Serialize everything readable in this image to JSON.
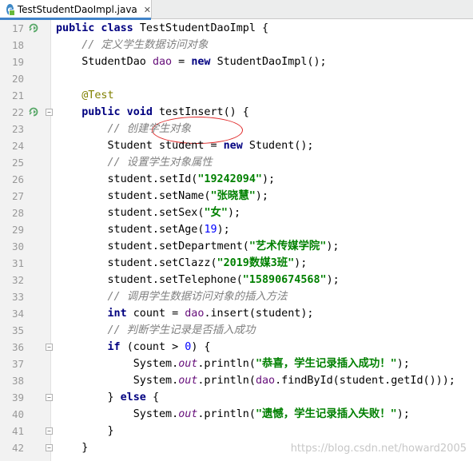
{
  "tab": {
    "title": "TestStudentDaoImpl.java",
    "icon": "class-c-icon"
  },
  "lines": [
    {
      "n": "17",
      "run": true,
      "fold": false,
      "tokens": [
        [
          "kw",
          "public class "
        ],
        [
          "t",
          "TestStudentDaoImpl {"
        ]
      ]
    },
    {
      "n": "18",
      "run": false,
      "fold": false,
      "tokens": [
        [
          "t",
          "    "
        ],
        [
          "cm",
          "// 定义学生数据访问对象"
        ]
      ]
    },
    {
      "n": "19",
      "run": false,
      "fold": false,
      "tokens": [
        [
          "t",
          "    StudentDao "
        ],
        [
          "fld",
          "dao"
        ],
        [
          "t",
          " = "
        ],
        [
          "kw",
          "new "
        ],
        [
          "t",
          "StudentDaoImpl();"
        ]
      ]
    },
    {
      "n": "20",
      "run": false,
      "fold": false,
      "tokens": []
    },
    {
      "n": "21",
      "run": false,
      "fold": false,
      "tokens": [
        [
          "t",
          "    "
        ],
        [
          "an",
          "@Test"
        ]
      ]
    },
    {
      "n": "22",
      "run": true,
      "fold": true,
      "tokens": [
        [
          "t",
          "    "
        ],
        [
          "kw",
          "public void "
        ],
        [
          "t",
          "testInsert() {"
        ]
      ]
    },
    {
      "n": "23",
      "run": false,
      "fold": false,
      "tokens": [
        [
          "t",
          "        "
        ],
        [
          "cm",
          "// 创建学生对象"
        ]
      ]
    },
    {
      "n": "24",
      "run": false,
      "fold": false,
      "tokens": [
        [
          "t",
          "        Student student = "
        ],
        [
          "kw",
          "new "
        ],
        [
          "t",
          "Student();"
        ]
      ]
    },
    {
      "n": "25",
      "run": false,
      "fold": false,
      "tokens": [
        [
          "t",
          "        "
        ],
        [
          "cm",
          "// 设置学生对象属性"
        ]
      ]
    },
    {
      "n": "26",
      "run": false,
      "fold": false,
      "tokens": [
        [
          "t",
          "        student.setId("
        ],
        [
          "str",
          "\"19242094\""
        ],
        [
          "t",
          ");"
        ]
      ]
    },
    {
      "n": "27",
      "run": false,
      "fold": false,
      "tokens": [
        [
          "t",
          "        student.setName("
        ],
        [
          "str",
          "\"张晓慧\""
        ],
        [
          "t",
          ");"
        ]
      ]
    },
    {
      "n": "28",
      "run": false,
      "fold": false,
      "tokens": [
        [
          "t",
          "        student.setSex("
        ],
        [
          "str",
          "\"女\""
        ],
        [
          "t",
          ");"
        ]
      ]
    },
    {
      "n": "29",
      "run": false,
      "fold": false,
      "tokens": [
        [
          "t",
          "        student.setAge("
        ],
        [
          "num",
          "19"
        ],
        [
          "t",
          ");"
        ]
      ]
    },
    {
      "n": "30",
      "run": false,
      "fold": false,
      "tokens": [
        [
          "t",
          "        student.setDepartment("
        ],
        [
          "str",
          "\"艺术传媒学院\""
        ],
        [
          "t",
          ");"
        ]
      ]
    },
    {
      "n": "31",
      "run": false,
      "fold": false,
      "tokens": [
        [
          "t",
          "        student.setClazz("
        ],
        [
          "str",
          "\"2019数媒3班\""
        ],
        [
          "t",
          ");"
        ]
      ]
    },
    {
      "n": "32",
      "run": false,
      "fold": false,
      "tokens": [
        [
          "t",
          "        student.setTelephone("
        ],
        [
          "str",
          "\"15890674568\""
        ],
        [
          "t",
          ");"
        ]
      ]
    },
    {
      "n": "33",
      "run": false,
      "fold": false,
      "tokens": [
        [
          "t",
          "        "
        ],
        [
          "cm",
          "// 调用学生数据访问对象的插入方法"
        ]
      ]
    },
    {
      "n": "34",
      "run": false,
      "fold": false,
      "tokens": [
        [
          "t",
          "        "
        ],
        [
          "kw",
          "int "
        ],
        [
          "t",
          "count = "
        ],
        [
          "fld",
          "dao"
        ],
        [
          "t",
          ".insert(student);"
        ]
      ]
    },
    {
      "n": "35",
      "run": false,
      "fold": false,
      "tokens": [
        [
          "t",
          "        "
        ],
        [
          "cm",
          "// 判断学生记录是否插入成功"
        ]
      ]
    },
    {
      "n": "36",
      "run": false,
      "fold": true,
      "tokens": [
        [
          "t",
          "        "
        ],
        [
          "kw",
          "if "
        ],
        [
          "t",
          "(count > "
        ],
        [
          "num",
          "0"
        ],
        [
          "t",
          ") {"
        ]
      ]
    },
    {
      "n": "37",
      "run": false,
      "fold": false,
      "tokens": [
        [
          "t",
          "            System."
        ],
        [
          "sfld",
          "out"
        ],
        [
          "t",
          ".println("
        ],
        [
          "str",
          "\"恭喜，学生记录插入成功！\""
        ],
        [
          "t",
          ");"
        ]
      ]
    },
    {
      "n": "38",
      "run": false,
      "fold": false,
      "tokens": [
        [
          "t",
          "            System."
        ],
        [
          "sfld",
          "out"
        ],
        [
          "t",
          ".println("
        ],
        [
          "fld",
          "dao"
        ],
        [
          "t",
          ".findById(student.getId()));"
        ]
      ]
    },
    {
      "n": "39",
      "run": false,
      "fold": true,
      "tokens": [
        [
          "t",
          "        } "
        ],
        [
          "kw",
          "else "
        ],
        [
          "t",
          "{"
        ]
      ]
    },
    {
      "n": "40",
      "run": false,
      "fold": false,
      "tokens": [
        [
          "t",
          "            System."
        ],
        [
          "sfld",
          "out"
        ],
        [
          "t",
          ".println("
        ],
        [
          "str",
          "\"遗憾，学生记录插入失败！\""
        ],
        [
          "t",
          ");"
        ]
      ]
    },
    {
      "n": "41",
      "run": false,
      "fold": true,
      "tokens": [
        [
          "t",
          "        }"
        ]
      ]
    },
    {
      "n": "42",
      "run": false,
      "fold": true,
      "tokens": [
        [
          "t",
          "    }"
        ]
      ]
    }
  ],
  "annotation": {
    "circled_text": "testInsert()"
  },
  "watermark": "https://blog.csdn.net/howard2005"
}
